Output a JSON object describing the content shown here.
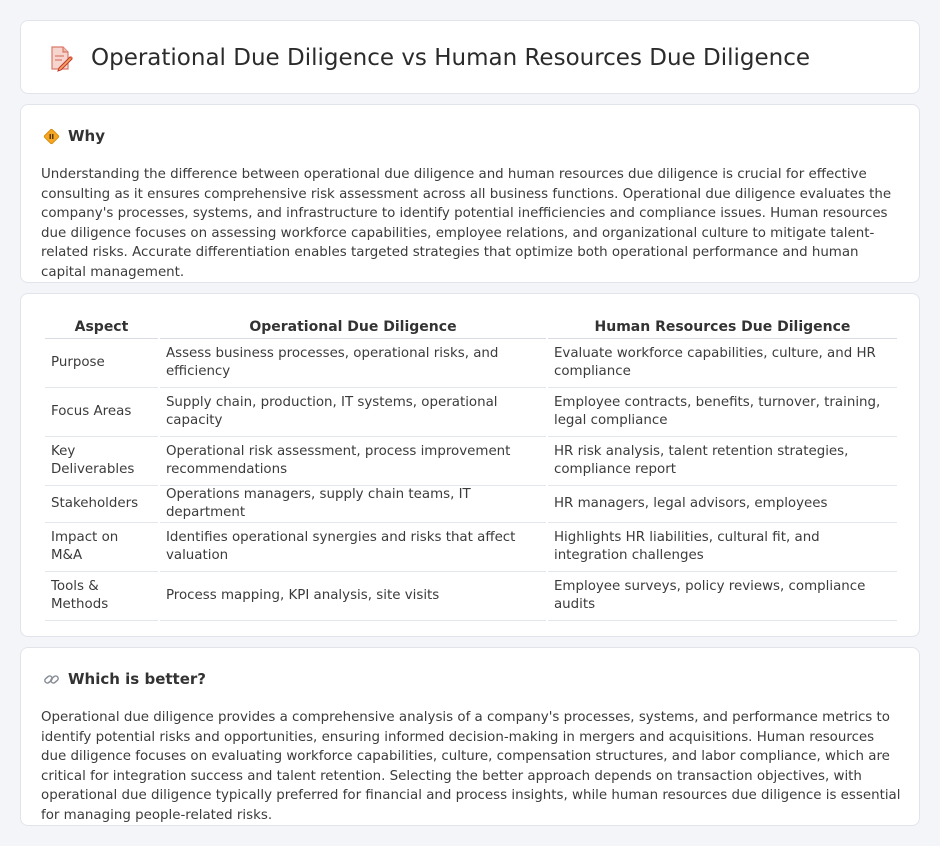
{
  "header": {
    "title": "Operational Due Diligence vs Human Resources Due Diligence",
    "icon": "document-pencil-icon"
  },
  "why": {
    "icon": "diamond-sign-icon",
    "title": "Why",
    "text": "Understanding the difference between operational due diligence and human resources due diligence is crucial for effective consulting as it ensures comprehensive risk assessment across all business functions. Operational due diligence evaluates the company's processes, systems, and infrastructure to identify potential inefficiencies and compliance issues. Human resources due diligence focuses on assessing workforce capabilities, employee relations, and organizational culture to mitigate talent-related risks. Accurate differentiation enables targeted strategies that optimize both operational performance and human capital management."
  },
  "comparison": {
    "headers": [
      "Aspect",
      "Operational Due Diligence",
      "Human Resources Due Diligence"
    ],
    "rows": [
      [
        "Purpose",
        "Assess business processes, operational risks, and efficiency",
        "Evaluate workforce capabilities, culture, and HR compliance"
      ],
      [
        "Focus Areas",
        "Supply chain, production, IT systems, operational capacity",
        "Employee contracts, benefits, turnover, training, legal compliance"
      ],
      [
        "Key Deliverables",
        "Operational risk assessment, process improvement recommendations",
        "HR risk analysis, talent retention strategies, compliance report"
      ],
      [
        "Stakeholders",
        "Operations managers, supply chain teams, IT department",
        "HR managers, legal advisors, employees"
      ],
      [
        "Impact on M&A",
        "Identifies operational synergies and risks that affect valuation",
        "Highlights HR liabilities, cultural fit, and integration challenges"
      ],
      [
        "Tools & Methods",
        "Process mapping, KPI analysis, site visits",
        "Employee surveys, policy reviews, compliance audits"
      ]
    ]
  },
  "better": {
    "icon": "link-icon",
    "title": "Which is better?",
    "text": "Operational due diligence provides a comprehensive analysis of a company's processes, systems, and performance metrics to identify potential risks and opportunities, ensuring informed decision-making in mergers and acquisitions. Human resources due diligence focuses on evaluating workforce capabilities, culture, compensation structures, and labor compliance, which are critical for integration success and talent retention. Selecting the better approach depends on transaction objectives, with operational due diligence typically preferred for financial and process insights, while human resources due diligence is essential for managing people-related risks."
  }
}
